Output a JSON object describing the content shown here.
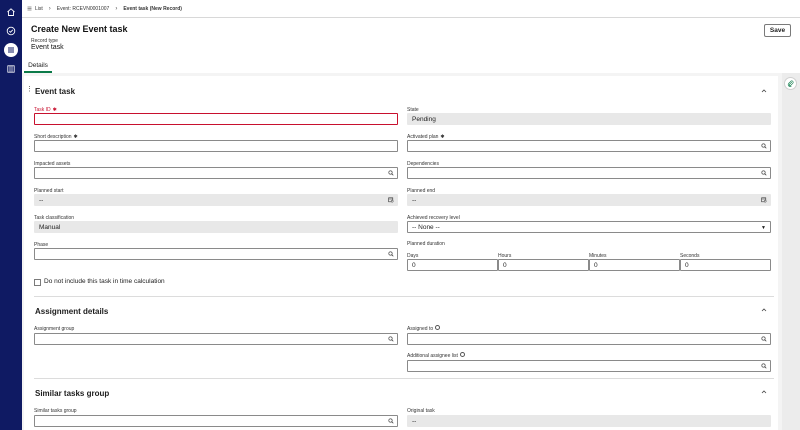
{
  "breadcrumb": {
    "list": "List",
    "parent": "Event: RCEVN0001007",
    "current": "Event task (New Record)"
  },
  "header": {
    "title": "Create New Event task",
    "record_type_label": "Record type",
    "record_type_value": "Event task",
    "save_label": "Save"
  },
  "tabs": [
    {
      "label": "Details"
    }
  ],
  "sections": {
    "event_task": "Event task",
    "assignment": "Assignment details",
    "similar": "Similar tasks group"
  },
  "fields": {
    "task_id": {
      "label": "Task ID",
      "value": ""
    },
    "state": {
      "label": "State",
      "value": "Pending"
    },
    "short_description": {
      "label": "Short description",
      "value": ""
    },
    "activated_plan": {
      "label": "Activated plan",
      "value": ""
    },
    "impacted_assets": {
      "label": "Impacted assets",
      "value": ""
    },
    "dependencies": {
      "label": "Dependencies",
      "value": ""
    },
    "planned_start": {
      "label": "Planned start",
      "value": "--"
    },
    "planned_end": {
      "label": "Planned end",
      "value": "--"
    },
    "task_classification": {
      "label": "Task classification",
      "value": "Manual"
    },
    "achieved_recovery_level": {
      "label": "Achieved recovery level",
      "value": "-- None --"
    },
    "phase": {
      "label": "Phase",
      "value": ""
    },
    "planned_duration": {
      "label": "Planned duration"
    },
    "days": {
      "label": "Days",
      "value": "0"
    },
    "hours": {
      "label": "Hours",
      "value": "0"
    },
    "minutes": {
      "label": "Minutes",
      "value": "0"
    },
    "seconds": {
      "label": "Seconds",
      "value": "0"
    },
    "exclude_time_calc": {
      "label": "Do not include this task in time calculation"
    },
    "assignment_group": {
      "label": "Assignment group",
      "value": ""
    },
    "assigned_to": {
      "label": "Assigned to",
      "value": ""
    },
    "additional_assignee_list": {
      "label": "Additional assignee list",
      "value": ""
    },
    "similar_tasks_group": {
      "label": "Similar tasks group",
      "value": ""
    },
    "original_task": {
      "label": "Original task",
      "value": "--"
    }
  },
  "required_mark": "✱",
  "colors": {
    "rail": "#0f1a63",
    "accent_tab": "#0b7a48",
    "error": "#c8102e"
  }
}
